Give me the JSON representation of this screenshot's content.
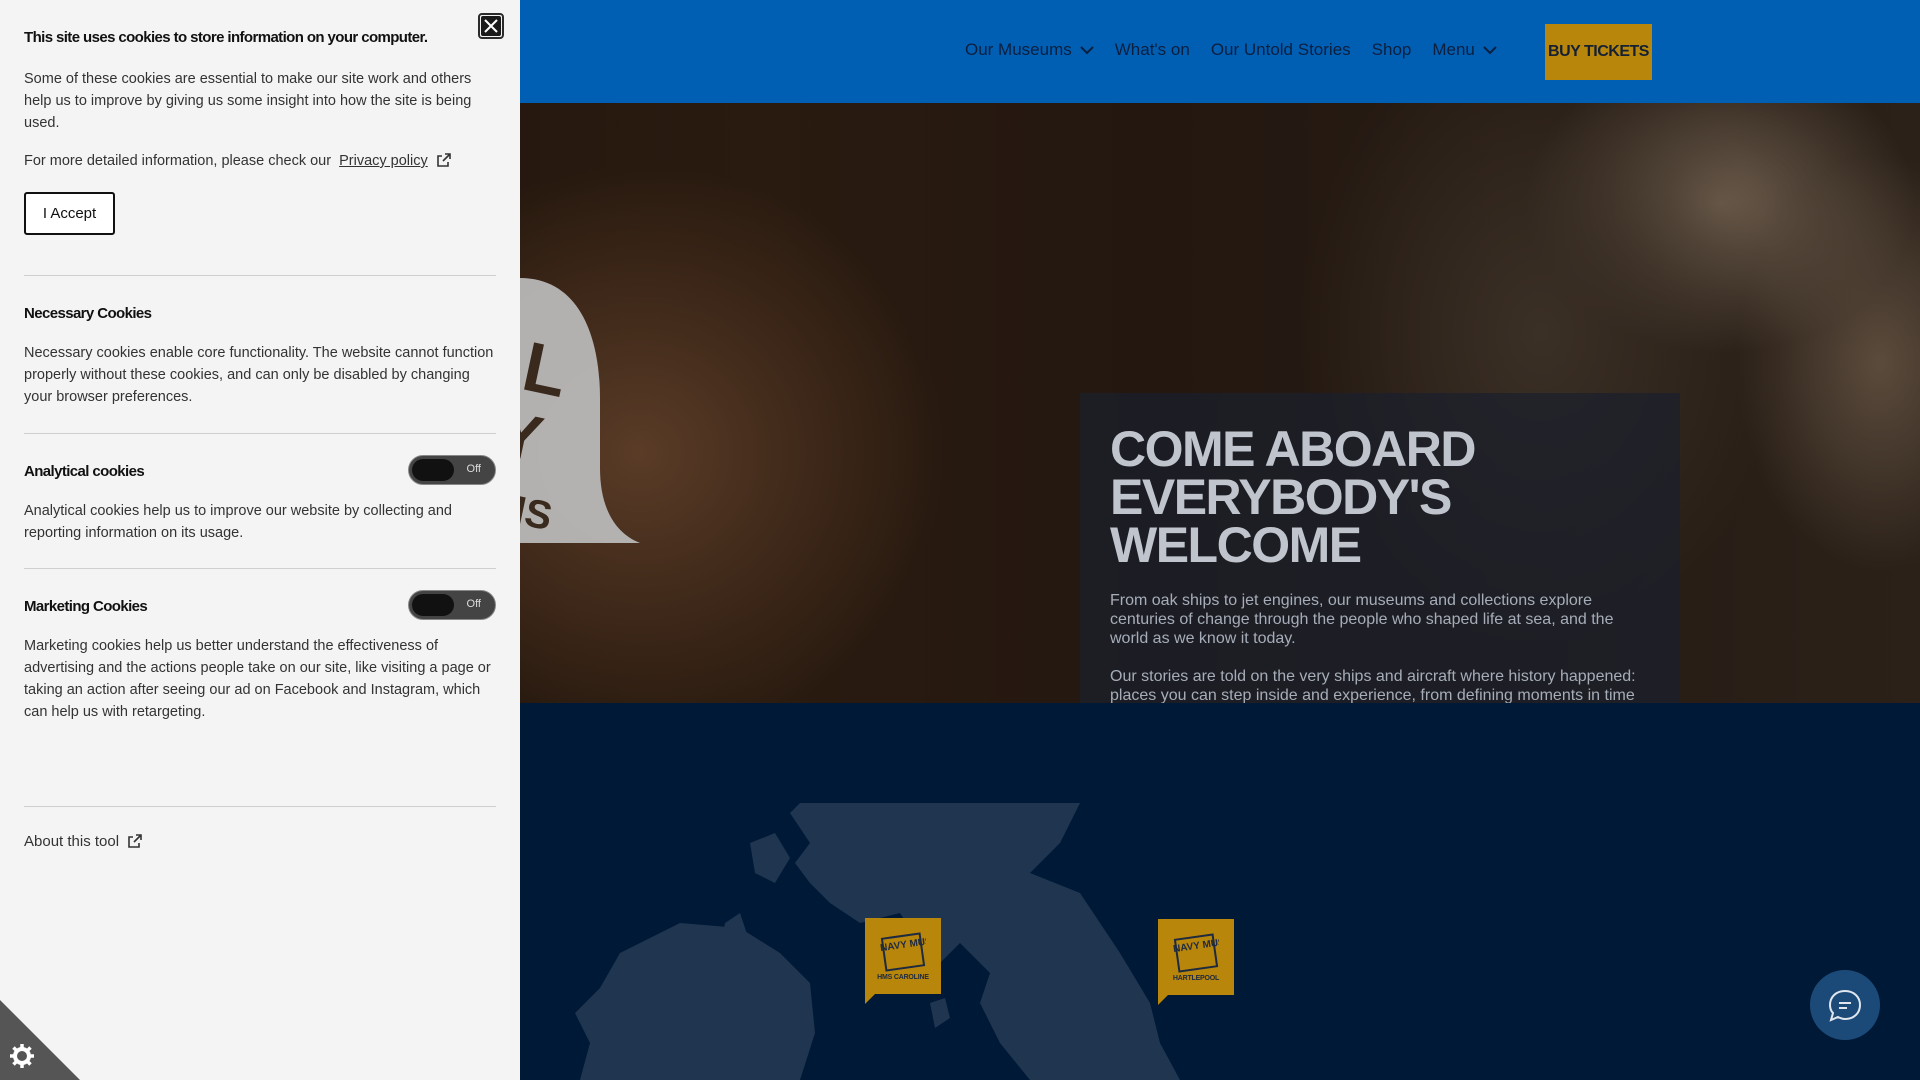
{
  "nav": {
    "items": [
      {
        "label": "Our Museums",
        "has_dropdown": true
      },
      {
        "label": "What's on",
        "has_dropdown": false
      },
      {
        "label": "Our Untold Stories",
        "has_dropdown": false
      },
      {
        "label": "Shop",
        "has_dropdown": false
      },
      {
        "label": "Menu",
        "has_dropdown": true
      }
    ],
    "buy_tickets_label": "BUY TICKETS"
  },
  "hero": {
    "title": "COME ABOARD EVERYBODY'S WELCOME",
    "paragraph_1": "From oak ships to jet engines, our museums and collections explore centuries of change through the people who shaped life at sea, and the world as we know it today.",
    "paragraph_2": "Our stories are told on the very ships and aircraft where history happened: places you can step inside and experience, from defining moments in time to the tough everyday realities of life on board.",
    "emblem_text": "AL Y MS"
  },
  "map": {
    "pins": [
      {
        "logo_text": "ROYAL NAVY MUSEUMS",
        "label": "HMS CAROLINE"
      },
      {
        "logo_text": "ROYAL NAVY MUSEUMS",
        "label": "HARTLEPOOL"
      }
    ]
  },
  "cookies": {
    "title": "This site uses cookies to store information on your computer.",
    "intro": "Some of these cookies are essential to make our site work and others help us to improve by giving us some insight into how the site is being used.",
    "info_prefix": "For more detailed information, please check our",
    "privacy_link": "Privacy policy",
    "accept_label": "I Accept",
    "necessary_title": "Necessary Cookies",
    "necessary_text": "Necessary cookies enable core functionality. The website cannot function properly without these cookies, and can only be disabled by changing your browser preferences.",
    "analytical_title": "Analytical cookies",
    "analytical_state": "Off",
    "analytical_text": "Analytical cookies help us to improve our website by collecting and reporting information on its usage.",
    "marketing_title": "Marketing Cookies",
    "marketing_state": "Off",
    "marketing_text": "Marketing cookies help us better understand the effectiveness of advertising and the actions people take on our site, like visiting a page or taking an action after seeing our ad on Facebook and Instagram, which can help us with retargeting.",
    "about_label": "About this tool"
  },
  "icons": {
    "close": "close-icon",
    "external": "external-link-icon",
    "chevron": "chevron-down-icon",
    "chat": "chat-icon",
    "cookie": "cog-icon"
  },
  "colors": {
    "header_bg": "#005fb3",
    "accent_gold": "#b8860b",
    "map_bg": "#001936",
    "panel_bg": "#f4f4f4"
  }
}
